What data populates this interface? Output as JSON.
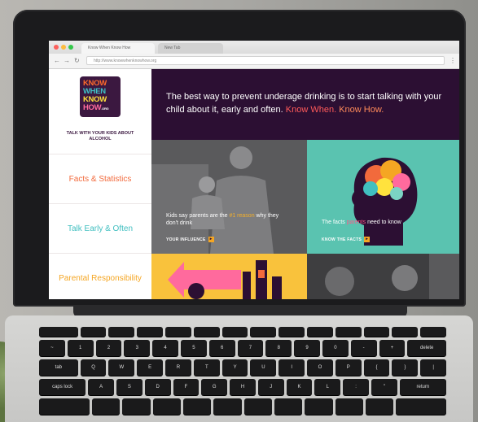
{
  "browser": {
    "active_tab": "Know When Know How",
    "inactive_tab": "New Tab",
    "url": "http://www.knowwhenknowhow.org"
  },
  "sidebar": {
    "logo_lines": [
      "KNOW",
      "WHEN",
      "KNOW",
      "HOW"
    ],
    "logo_org": ".ORG",
    "tagline": "TALK WITH YOUR KIDS ABOUT ALCOHOL",
    "nav": [
      "Facts & Statistics",
      "Talk Early & Often",
      "Parental Responsibility"
    ]
  },
  "hero": {
    "text": "The best way to prevent underage drinking is to start talking with your child about it, early and often.",
    "highlight1": "Know When.",
    "highlight2": "Know How."
  },
  "tiles": {
    "tile1_caption_pre": "Kids say parents are the",
    "tile1_caption_hl": "#1 reason",
    "tile1_caption_post": "why they don't drink",
    "tile1_cta": "YOUR INFLUENCE",
    "tile2_caption_pre": "The facts",
    "tile2_caption_hl": "parents",
    "tile2_caption_post": "need to know",
    "tile2_cta": "KNOW THE FACTS"
  },
  "keyboard": {
    "row_num": [
      "~",
      "1",
      "2",
      "3",
      "4",
      "5",
      "6",
      "7",
      "8",
      "9",
      "0",
      "-",
      "+",
      "delete"
    ],
    "row_q": [
      "tab",
      "Q",
      "W",
      "E",
      "R",
      "T",
      "Y",
      "U",
      "I",
      "O",
      "P",
      "{",
      "}",
      "|"
    ],
    "row_a": [
      "caps lock",
      "A",
      "S",
      "D",
      "F",
      "G",
      "H",
      "J",
      "K",
      "L",
      ":",
      "\"",
      "return"
    ]
  },
  "colors": {
    "hero_bg": "#2c0f33",
    "accent_orange": "#f26a3c",
    "accent_teal": "#41bfc0",
    "accent_yellow": "#f5a623"
  }
}
